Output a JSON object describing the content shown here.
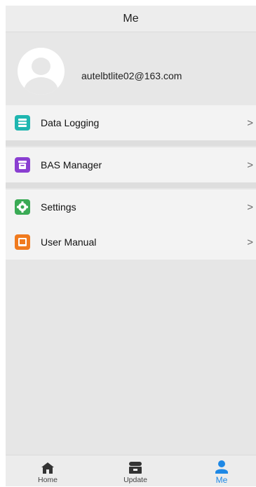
{
  "header": {
    "title": "Me"
  },
  "profile": {
    "email": "autelbtlite02@163.com"
  },
  "menu": {
    "data_logging": {
      "label": "Data Logging",
      "chevron": ">"
    },
    "bas_manager": {
      "label": "BAS Manager",
      "chevron": ">"
    },
    "settings": {
      "label": "Settings",
      "chevron": ">"
    },
    "user_manual": {
      "label": "User Manual",
      "chevron": ">"
    }
  },
  "tabs": {
    "home": {
      "label": "Home",
      "icon": "home-icon"
    },
    "update": {
      "label": "Update",
      "icon": "store-icon"
    },
    "me": {
      "label": "Me",
      "icon": "person-icon",
      "active": true
    }
  },
  "colors": {
    "data_logging_icon": "#1fb6b0",
    "bas_manager_icon": "#8a3fd1",
    "settings_icon": "#3aaa55",
    "user_manual_icon": "#f07a1e",
    "active_tab": "#1e88e5"
  }
}
